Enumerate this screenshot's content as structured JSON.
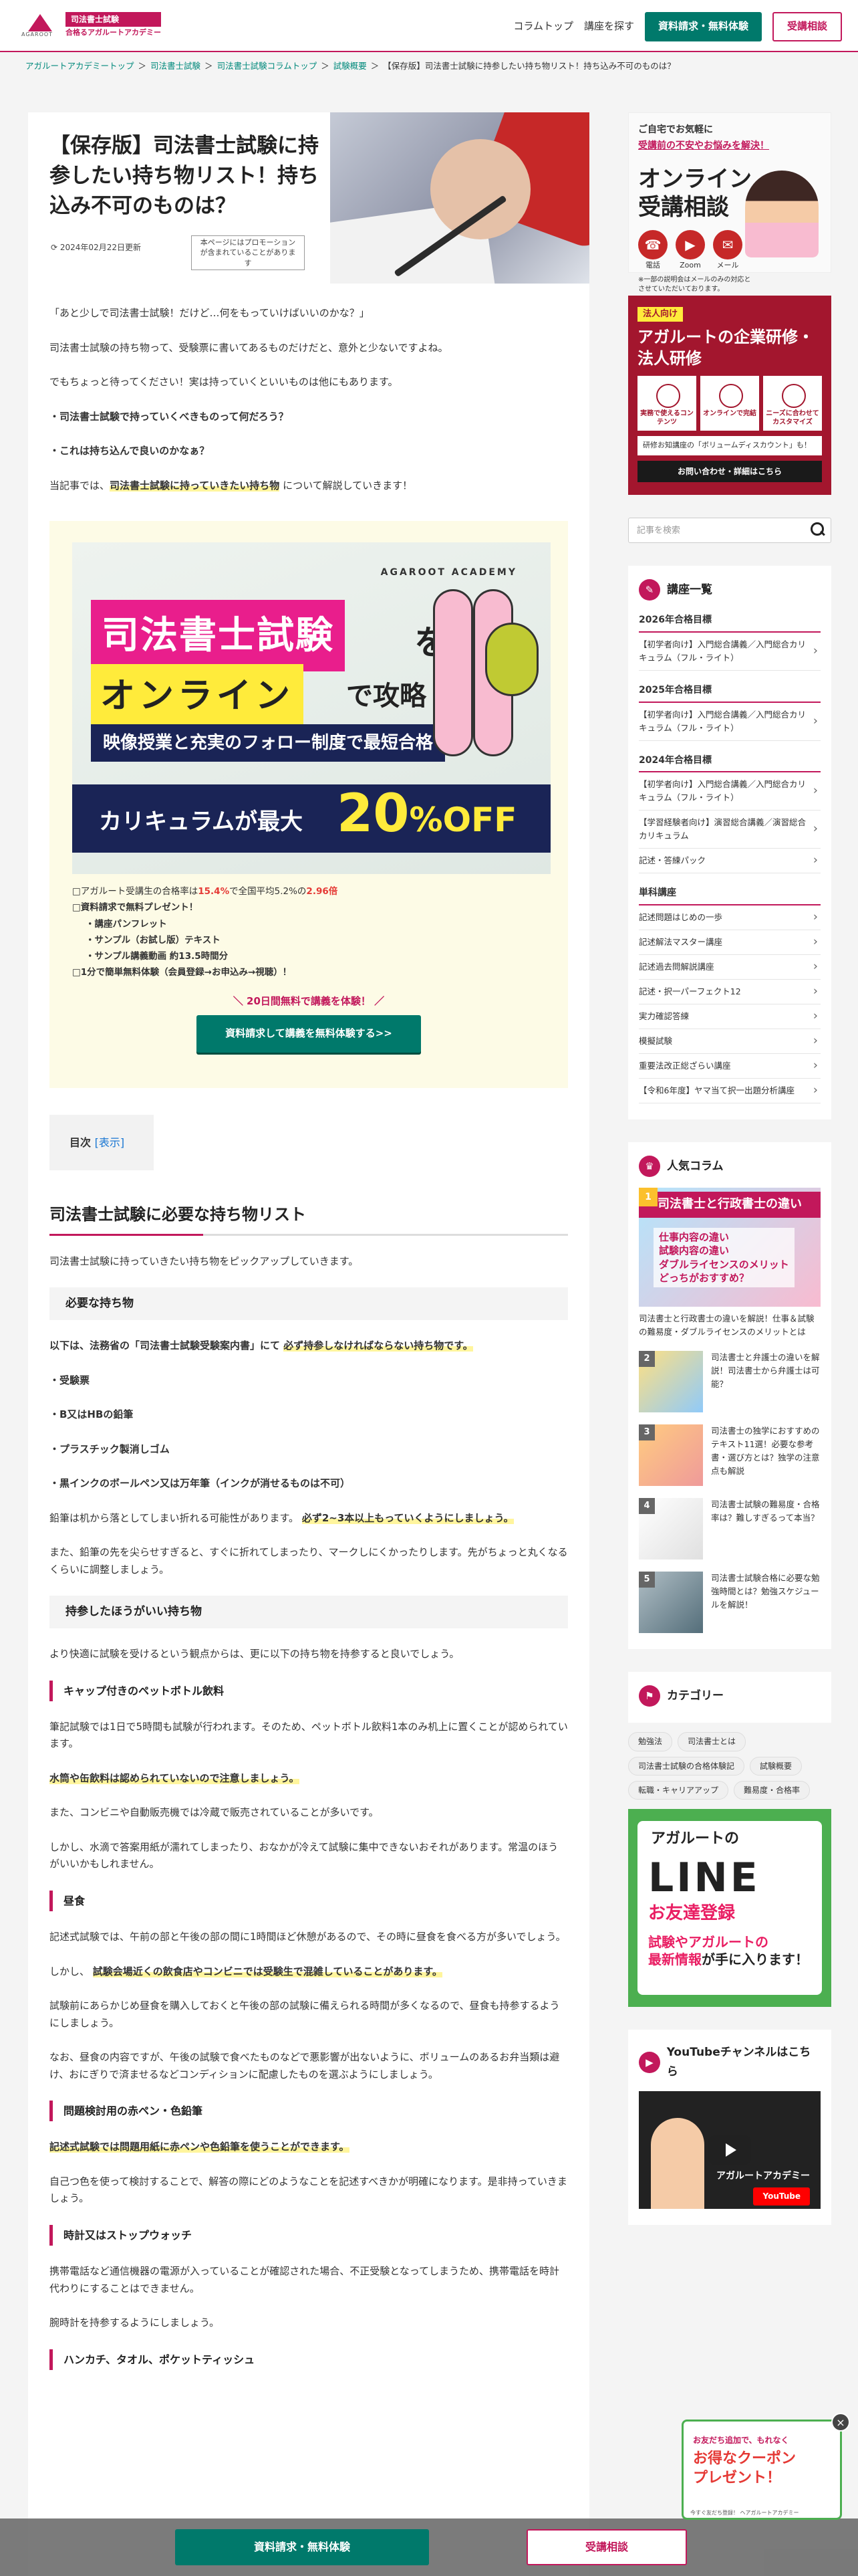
{
  "header": {
    "logo_sub": "AGAROOT",
    "logo_line1": "司法書士試験",
    "logo_line2": "合格るアガルートアカデミー",
    "nav": [
      "コラムトップ",
      "講座を探す"
    ],
    "btn_request": "資料請求・無料体験",
    "btn_consult": "受講相談"
  },
  "breadcrumb": [
    "アガルートアカデミートップ",
    "司法書士試験",
    "司法書士試験コラムトップ",
    "試験概要",
    "【保存版】司法書士試験に持参したい持ち物リスト！持ち込み不可のものは？"
  ],
  "article": {
    "title": "【保存版】司法書士試験に持参したい持ち物リスト！持ち込み不可のものは？",
    "date": "2024年02月22日更新",
    "promo_note": "本ページにはプロモーションが含まれていることがあります",
    "intro": [
      "「あと少しで司法書士試験！だけど…何をもっていけばいいのかな？」",
      "司法書士試験の持ち物って、受験票に書いてあるものだけだと、意外と少ないですよね。",
      "でもちょっと待ってください！実は持っていくといいものは他にもあります。",
      "・司法書士試験で持っていくべきものって何だろう？",
      "・これは持ち込んで良いのかなぁ？"
    ],
    "intro_last_a": "当記事では、",
    "intro_last_hl": "司法書士試験に持っていきたい持ち物",
    "intro_last_b": "について解説していきます！"
  },
  "banner": {
    "brand": "AGAROOT ACADEMY",
    "t1": "司法書士試験",
    "t1b": "を",
    "t2": "オンライン",
    "t2b": "で攻略",
    "t3": "映像授業と充実のフォロー制度で最短合格",
    "t4": "カリキュラムが最大",
    "t5": "20",
    "t5b": "%OFF",
    "l1a": "アガルート受講生の合格率は",
    "l1b": "15.4%",
    "l1c": "で全国平均5.2%の",
    "l1d": "2.96倍",
    "l2": "資料請求で無料プレゼント！",
    "l3": "・講座パンフレット",
    "l4": "・サンプル（お試し版）テキスト",
    "l5": "・サンプル講義動画 約13.5時間分",
    "l6": "1分で簡単無料体験（会員登録→お申込み→視聴）！",
    "cta_label": "＼ 20日間無料で講義を体験！ ／",
    "cta": "資料請求して講義を無料体験する>>"
  },
  "toc": {
    "title": "目次",
    "toggle": "[表示]"
  },
  "sec1": {
    "h2": "司法書士試験に必要な持ち物リスト",
    "p1": "司法書士試験に持っていきたい持ち物をピックアップしていきます。",
    "h3a": "必要な持ち物",
    "p2a": "以下は、法務省の「司法書士試験受験案内書」にて",
    "p2hl": "必ず持参しなければならない持ち物です。",
    "items": [
      "・受験票",
      "・B又はHBの鉛筆",
      "・プラスチック製消しゴム",
      "・黒インクのボールペン又は万年筆（インクが消せるものは不可）"
    ],
    "p3a": "鉛筆は机から落としてしまい折れる可能性があります。",
    "p3hl": "必ず2~3本以上もっていくようにしましょう。",
    "p4": "また、鉛筆の先を尖らせすぎると、すぐに折れてしまったり、マークしにくかったりします。先がちょっと丸くなるくらいに調整しましょう。",
    "h3b": "持参したほうがいい持ち物",
    "p5": "より快適に試験を受けるという観点からは、更に以下の持ち物を持参すると良いでしょう。",
    "h4a": "キャップ付きのペットボトル飲料",
    "p6": "筆記試験では1日で5時間も試験が行われます。そのため、ペットボトル飲料1本のみ机上に置くことが認められています。",
    "p7hl": "水筒や缶飲料は認められていないので注意しましょう。",
    "p8": "また、コンビニや自動販売機では冷蔵で販売されていることが多いです。",
    "p9": "しかし、水滴で答案用紙が濡れてしまったり、おなかが冷えて試験に集中できないおそれがあります。常温のほうがいいかもしれません。",
    "h4b": "昼食",
    "p10": "記述式試験では、午前の部と午後の部の間に1時間ほど休憩があるので、その時に昼食を食べる方が多いでしょう。",
    "p11a": "しかし、",
    "p11hl": "試験会場近くの飲食店やコンビニでは受験生で混雑していることがあります。",
    "p12": "試験前にあらかじめ昼食を購入しておくと午後の部の試験に備えられる時間が多くなるので、昼食も持参するようにしましょう。",
    "p13": "なお、昼食の内容ですが、午後の試験で食べたものなどで悪影響が出ないように、ボリュームのあるお弁当類は避け、おにぎりで済ませるなどコンディションに配慮したものを選ぶようにしましょう。",
    "h4c": "問題検討用の赤ペン・色鉛筆",
    "p14hl": "記述式試験では問題用紙に赤ペンや色鉛筆を使うことができます。",
    "p15": "自己つ色を使って検討することで、解答の際にどのようなことを記述すべきかが明確になります。是非持っていきましょう。",
    "h4d": "時計又はストップウォッチ",
    "p16": "携帯電話など通信機器の電源が入っていることが確認された場合、不正受験となってしまうため、携帯電話を時計代わりにすることはできません。",
    "p17": "腕時計を持参するようにしましょう。",
    "h4e": "ハンカチ、タオル、ポケットティッシュ"
  },
  "sidebar": {
    "ad1": {
      "a1": "ご自宅でお気軽に",
      "a2": "受講前の不安やお悩みを解決！",
      "a3": "オンライン受講相談",
      "icons": [
        "電話",
        "Zoom",
        "メール"
      ],
      "note": "※一部の説明会はメールのみの対応とさせていただいております。"
    },
    "ad2": {
      "badge": "法人向け",
      "title": "アガルートの企業研修・法人研修",
      "boxes": [
        "実務で使えるコンテンツ",
        "オンラインで完結",
        "ニーズに合わせてカスタマイズ"
      ],
      "note": "研修お知講座の「ボリュームディスカウント」も！",
      "cta": "お問い合わせ・詳細はこちら"
    },
    "search_placeholder": "記事を検索",
    "courses": {
      "title": "講座一覧",
      "groups": [
        {
          "label": "2026年合格目標",
          "links": [
            "【初学者向け】入門総合講義／入門総合カリキュラム（フル・ライト）"
          ]
        },
        {
          "label": "2025年合格目標",
          "links": [
            "【初学者向け】入門総合講義／入門総合カリキュラム（フル・ライト）"
          ]
        },
        {
          "label": "2024年合格目標",
          "links": [
            "【初学者向け】入門総合講義／入門総合カリキュラム（フル・ライト）",
            "【学習経験者向け】演習総合講義／演習総合カリキュラム",
            "記述・答練パック"
          ]
        },
        {
          "label": "単科講座",
          "links": [
            "記述問題はじめの一歩",
            "記述解法マスター講座",
            "記述過去問解説講座",
            "記述・択一パーフェクト12",
            "実力確認答練",
            "模擬試験",
            "重要法改正総ざらい講座",
            "【令和6年度】ヤマ当て択一出題分析講座"
          ]
        }
      ]
    },
    "popular": {
      "title": "人気コラム",
      "top_banner": "司法書士と行政書士の違い",
      "top_q": "仕事内容の違い\n試験内容の違い\nダブルライセンスのメリット\nどっちがおすすめ？",
      "items": [
        "司法書士と行政書士の違いを解説！仕事＆試験の難易度・ダブルライセンスのメリットとは",
        "司法書士と弁護士の違いを解説！司法書士から弁護士は可能？",
        "司法書士の独学におすすめのテキスト11選！必要な参考書・選び方とは？独学の注意点も解説",
        "司法書士試験の難易度・合格率は？難しすぎるって本当？",
        "司法書士試験合格に必要な勉強時間とは？勉強スケジュールを解説！"
      ],
      "ranks": [
        "1",
        "2",
        "3",
        "4",
        "5"
      ]
    },
    "category": {
      "title": "カテゴリー",
      "tags": [
        "勉強法",
        "司法書士とは",
        "司法書士試験の合格体験記",
        "試験概要",
        "転職・キャリアアップ",
        "難易度・合格率"
      ]
    },
    "line_ad": {
      "l2": "アガルートの",
      "l3": "LINE",
      "l4": "お友達登録",
      "l5a": "試験やアガルートの",
      "l5b": "最新情報",
      "l5c": "が手に入ります！"
    },
    "youtube": {
      "title": "YouTubeチャンネルはこちら",
      "name": "アガルートアカデミー",
      "btn": "YouTube"
    }
  },
  "coupon": {
    "c1": "お友だち追加で、もれなく",
    "c2": "お得なクーポン\nプレゼント！",
    "c3": "今すぐ友だち登録！ ヘアガルートアカデミー"
  },
  "bottom": {
    "request": "資料請求・無料体験",
    "consult": "受講相談"
  },
  "colors": {
    "accent": "#c2185b",
    "green": "#00796b"
  }
}
